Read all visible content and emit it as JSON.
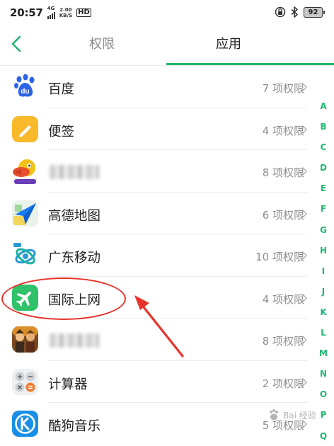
{
  "status_bar": {
    "time": "20:57",
    "network_type": "4G",
    "speed_value": "2.00",
    "speed_unit": "KB/S",
    "hd": "HD",
    "battery": "92",
    "icons": [
      "signal-icon",
      "lock-rotation-icon",
      "bluetooth-icon",
      "battery-icon"
    ]
  },
  "header": {
    "back_icon": "chevron-left-icon",
    "tabs": [
      {
        "label": "权限",
        "active": false
      },
      {
        "label": "应用",
        "active": true
      }
    ],
    "accent_color": "#22b873"
  },
  "apps": [
    {
      "name": "百度",
      "count": "7 项权限",
      "icon": "baidu-paw-icon"
    },
    {
      "name": "便签",
      "count": "4 项权限",
      "icon": "notes-pencil-icon"
    },
    {
      "name": "",
      "count": "8 项权限",
      "icon": "game-duck-icon"
    },
    {
      "name": "高德地图",
      "count": "6 项权限",
      "icon": "amap-arrow-icon"
    },
    {
      "name": "广东移动",
      "count": "10 项权限",
      "icon": "china-mobile-icon"
    },
    {
      "name": "国际上网",
      "count": "4 项权限",
      "icon": "airplane-icon"
    },
    {
      "name": "",
      "count": "8 项权限",
      "icon": "game-characters-icon"
    },
    {
      "name": "计算器",
      "count": "2 项权限",
      "icon": "calculator-icon"
    },
    {
      "name": "酷狗音乐",
      "count": "5 项权限",
      "icon": "kugou-k-icon"
    }
  ],
  "alphabet": [
    "A",
    "B",
    "C",
    "D",
    "E",
    "F",
    "G",
    "H",
    "I",
    "J",
    "K",
    "L",
    "M",
    "N",
    "O",
    "P",
    "Q"
  ],
  "watermark": "Bai 经验",
  "annotation_color": "#e8332a"
}
